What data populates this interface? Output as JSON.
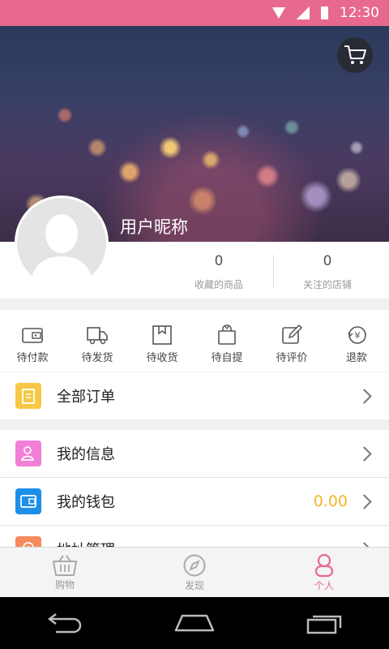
{
  "status_bar": {
    "time": "12:30"
  },
  "profile": {
    "nickname": "用户昵称",
    "stats": [
      {
        "value": "0",
        "label": "收藏的商品"
      },
      {
        "value": "0",
        "label": "关注的店铺"
      }
    ]
  },
  "orders": [
    {
      "label": "待付款",
      "icon": "wallet-icon"
    },
    {
      "label": "待发货",
      "icon": "truck-icon"
    },
    {
      "label": "待收货",
      "icon": "box-icon"
    },
    {
      "label": "待自提",
      "icon": "bag-icon"
    },
    {
      "label": "待评价",
      "icon": "edit-icon"
    },
    {
      "label": "退款",
      "icon": "refund-icon"
    }
  ],
  "menu": {
    "all_orders": {
      "label": "全部订单",
      "color": "#f6c846"
    },
    "my_info": {
      "label": "我的信息",
      "color": "#f27fd7"
    },
    "my_wallet": {
      "label": "我的钱包",
      "value": "0.00",
      "color": "#1e8fe8"
    },
    "address": {
      "label": "地址管理",
      "color": "#f58a5c"
    }
  },
  "bottom_nav": [
    {
      "label": "购物",
      "icon": "basket-icon"
    },
    {
      "label": "发现",
      "icon": "compass-icon"
    },
    {
      "label": "个人",
      "icon": "person-icon",
      "active": true
    }
  ],
  "accent_color": "#e8698f"
}
